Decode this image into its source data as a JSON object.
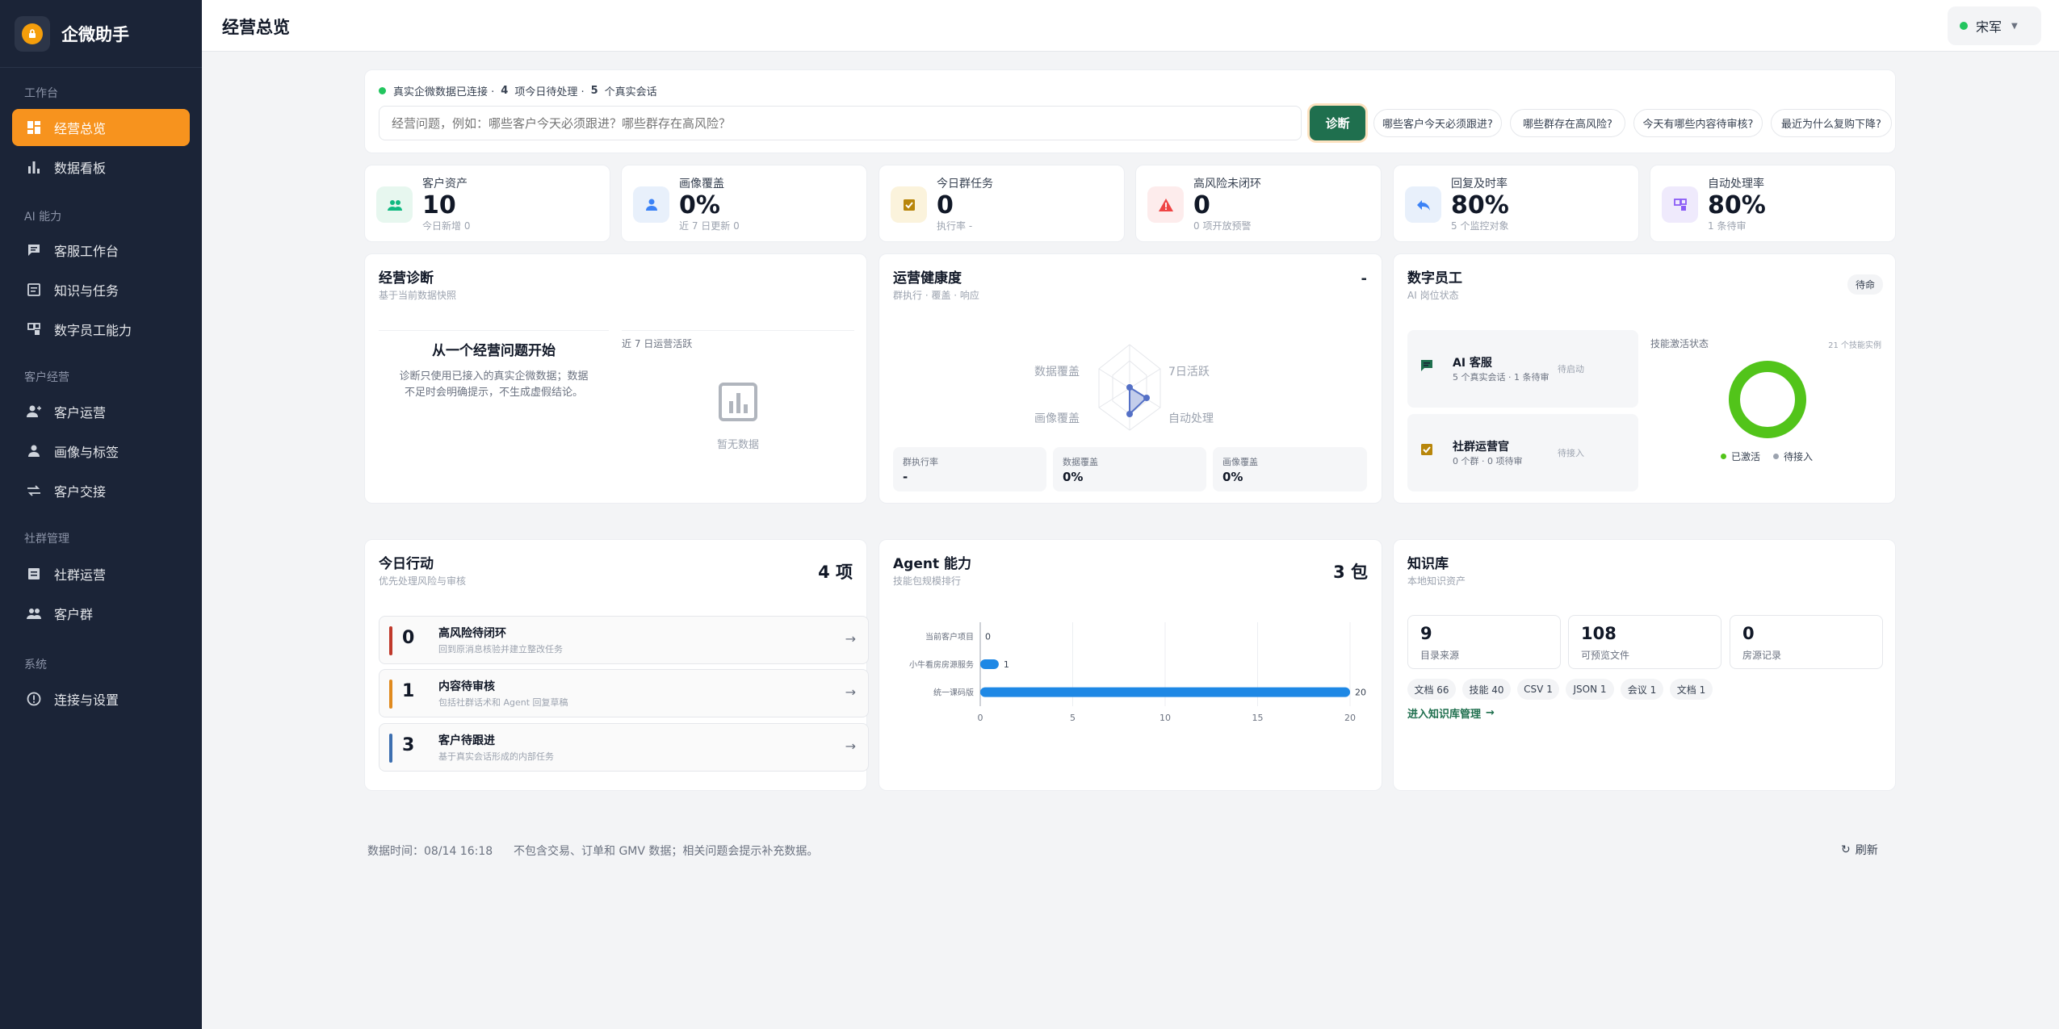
{
  "app": {
    "brand": "企微助手"
  },
  "sidebar": {
    "groups": [
      {
        "label": "工作台",
        "items": [
          {
            "label": "经营总览",
            "icon": "dashboard-icon",
            "active": true
          },
          {
            "label": "数据看板",
            "icon": "bar-chart-icon"
          }
        ]
      },
      {
        "label": "AI 能力",
        "items": [
          {
            "label": "客服工作台",
            "icon": "chat-icon"
          },
          {
            "label": "知识与任务",
            "icon": "document-icon"
          },
          {
            "label": "数字员工能力",
            "icon": "robot-icon"
          }
        ]
      },
      {
        "label": "客户经营",
        "items": [
          {
            "label": "客户运营",
            "icon": "person-add-icon"
          },
          {
            "label": "画像与标签",
            "icon": "person-icon"
          },
          {
            "label": "客户交接",
            "icon": "swap-icon"
          }
        ]
      },
      {
        "label": "社群管理",
        "items": [
          {
            "label": "社群运营",
            "icon": "list-icon"
          },
          {
            "label": "客户群",
            "icon": "group-icon"
          }
        ]
      },
      {
        "label": "系统",
        "items": [
          {
            "label": "连接与设置",
            "icon": "info-circle-icon"
          }
        ]
      }
    ]
  },
  "header": {
    "title": "经营总览",
    "user": "宋军"
  },
  "ai_bar": {
    "status_prefix": "真实企微数据已连接 ·",
    "todo_count": "4",
    "todo_text": "项今日待处理 ·",
    "session_count": "5",
    "session_text": "个真实会话",
    "placeholder": "经营问题，例如：哪些客户今天必须跟进？哪些群存在高风险？",
    "button": "诊断",
    "suggestions": [
      "哪些客户今天必须跟进?",
      "哪些群存在高风险?",
      "今天有哪些内容待审核?",
      "最近为什么复购下降?"
    ]
  },
  "kpis": [
    {
      "label": "客户资产",
      "value": "10",
      "sub": "今日新增 0",
      "icon": "people-icon",
      "color": "#10b981",
      "bg": "#e7f7ef"
    },
    {
      "label": "画像覆盖",
      "value": "0%",
      "sub": "近 7 日更新 0",
      "icon": "person-icon",
      "color": "#3b82f6",
      "bg": "#e8f0fb"
    },
    {
      "label": "今日群任务",
      "value": "0",
      "sub": "执行率 -",
      "icon": "checkbox-icon",
      "color": "#b8860b",
      "bg": "#fbf3dc"
    },
    {
      "label": "高风险未闭环",
      "value": "0",
      "sub": "0 项开放预警",
      "icon": "warning-icon",
      "color": "#ef4444",
      "bg": "#fdecec"
    },
    {
      "label": "回复及时率",
      "value": "80%",
      "sub": "5 个监控对象",
      "icon": "reply-icon",
      "color": "#3b82f6",
      "bg": "#e8f0fb"
    },
    {
      "label": "自动处理率",
      "value": "80%",
      "sub": "1 条待审",
      "icon": "robot-icon",
      "color": "#8b5cf6",
      "bg": "#efeafc"
    }
  ],
  "diagnosis": {
    "title": "经营诊断",
    "sub": "基于当前数据快照",
    "empty_title": "从一个经营问题开始",
    "empty_desc_1": "诊断只使用已接入的真实企微数据；数据",
    "empty_desc_2": "不足时会明确提示，不生成虚假结论。",
    "chart_label": "近 7 日运营活跃",
    "no_data": "暂无数据"
  },
  "health": {
    "title": "运营健康度",
    "sub": "群执行 · 覆盖 · 响应",
    "score": "-",
    "radar_labels": [
      "数据覆盖",
      "7日活跃",
      "自动处理",
      "画像覆盖"
    ],
    "metrics": [
      {
        "label": "群执行率",
        "value": "-"
      },
      {
        "label": "数据覆盖",
        "value": "0%"
      },
      {
        "label": "画像覆盖",
        "value": "0%"
      }
    ]
  },
  "digital": {
    "title": "数字员工",
    "sub": "AI 岗位状态",
    "badge": "待命",
    "agents": [
      {
        "name": "AI 客服",
        "desc": "5 个真实会话 · 1 条待审",
        "status": "待启动",
        "icon": "chat-icon",
        "color": "#1f6f4e"
      },
      {
        "name": "社群运营官",
        "desc": "0 个群 · 0 项待审",
        "status": "待接入",
        "icon": "checkbox-icon",
        "color": "#b8860b"
      }
    ],
    "donut_title": "技能激活状态",
    "donut_note": "21 个技能实例",
    "legend": [
      "已激活",
      "待接入"
    ],
    "activated_ratio": 1.0
  },
  "today": {
    "title": "今日行动",
    "sub": "优先处理风险与审核",
    "total": "4 项",
    "actions": [
      {
        "count": "0",
        "title": "高风险待闭环",
        "desc": "回到原消息核验并建立整改任务",
        "color": "#c0392b"
      },
      {
        "count": "1",
        "title": "内容待审核",
        "desc": "包括社群话术和 Agent 回复草稿",
        "color": "#e08a1e"
      },
      {
        "count": "3",
        "title": "客户待跟进",
        "desc": "基于真实会话形成的内部任务",
        "color": "#3d6fb0"
      }
    ]
  },
  "agent": {
    "title": "Agent 能力",
    "sub": "技能包规模排行",
    "total": "3 包"
  },
  "chart_data": {
    "type": "bar",
    "orientation": "horizontal",
    "categories": [
      "当前客户项目",
      "小牛看房房源服务",
      "统一课码版"
    ],
    "values": [
      0,
      1,
      20
    ],
    "xlim": [
      0,
      20
    ],
    "xticks": [
      0,
      5,
      10,
      15,
      20
    ],
    "color": "#1e88e5"
  },
  "kb": {
    "title": "知识库",
    "sub": "本地知识资产",
    "stats": [
      {
        "value": "9",
        "label": "目录来源"
      },
      {
        "value": "108",
        "label": "可预览文件"
      },
      {
        "value": "0",
        "label": "房源记录"
      }
    ],
    "tags": [
      "文档 66",
      "技能 40",
      "CSV 1",
      "JSON 1",
      "会议 1",
      "文档 1"
    ],
    "link": "进入知识库管理"
  },
  "footer": {
    "time": "数据时间：08/14 16:18",
    "note": "不包含交易、订单和 GMV 数据；相关问题会提示补充数据。",
    "refresh": "刷新"
  }
}
